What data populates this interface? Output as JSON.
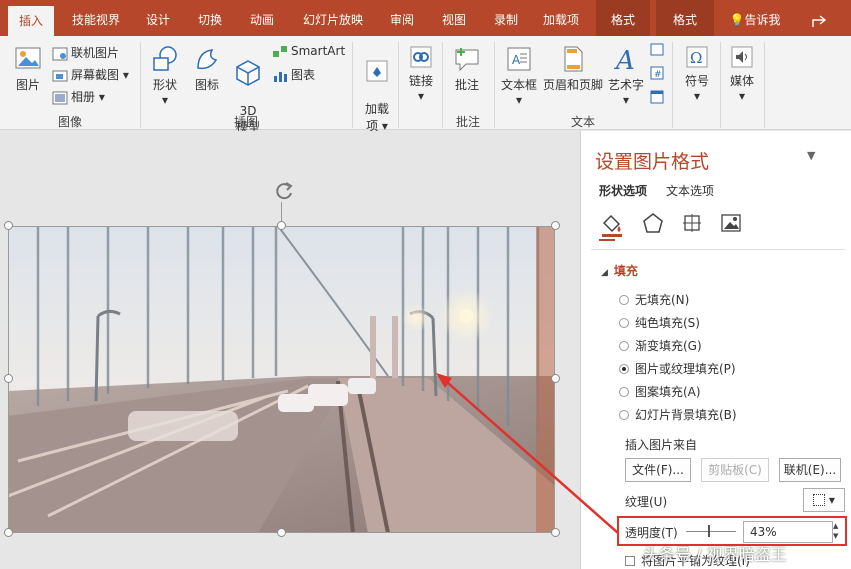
{
  "tabs": [
    "插入",
    "技能视界",
    "设计",
    "切换",
    "动画",
    "幻灯片放映",
    "审阅",
    "视图",
    "录制",
    "加载项",
    "格式",
    "格式"
  ],
  "tellme": "告诉我",
  "ribbon": {
    "picture": "图片",
    "online_picture": "联机图片",
    "screenshot": "屏幕截图",
    "album": "相册",
    "group_image": "图像",
    "shapes": "形状",
    "icons": "图标",
    "model3d": "3D\n模型",
    "smartart": "SmartArt",
    "chart": "图表",
    "group_illustrations": "插图",
    "addins": "加载\n项",
    "link": "链接",
    "comment": "批注",
    "group_comment": "批注",
    "textbox": "文本框",
    "header_footer": "页眉和页脚",
    "wordart": "艺术字",
    "group_text": "文本",
    "symbol": "符号",
    "media": "媒体"
  },
  "pane": {
    "title": "设置图片格式",
    "tab_shape": "形状选项",
    "tab_text": "文本选项",
    "section_fill": "填充",
    "fill_options": [
      "无填充(N)",
      "纯色填充(S)",
      "渐变填充(G)",
      "图片或纹理填充(P)",
      "图案填充(A)",
      "幻灯片背景填充(B)"
    ],
    "selected_fill": "图片或纹理填充(P)",
    "insert_from": "插入图片来自",
    "btn_file": "文件(F)...",
    "btn_clipboard": "剪贴板(C)",
    "btn_online": "联机(E)...",
    "texture": "纹理(U)",
    "transparency": "透明度(T)",
    "transparency_value": "43%",
    "transparency_level": 43,
    "tile_option": "将图片平铺为纹理(I)"
  },
  "watermark": "头条号 / 视界暗盗王",
  "colors": {
    "accent": "#b7472a",
    "annotation": "#e0312b"
  }
}
